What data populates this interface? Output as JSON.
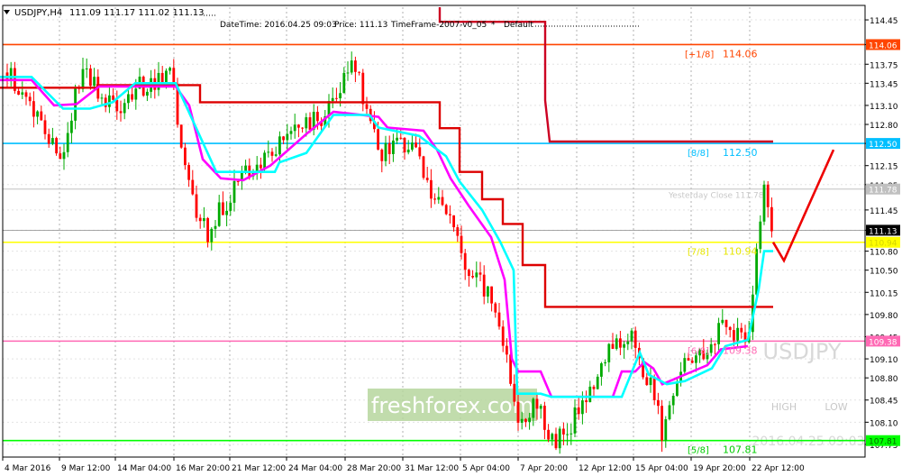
{
  "chart_data": {
    "type": "candlestick",
    "symbol_header": "USDJPY,H4",
    "ohlc_header": "111.09 111.17 111.02 111.13",
    "info": {
      "datetime": "DateTime: 2016.04.25 09:03",
      "price": "Price: 111.13",
      "timeframe": "TimeFrame-2007-v0_05",
      "preset": "Default"
    },
    "ylim": [
      107.55,
      114.65
    ],
    "y_ticks": [
      "114.45",
      "114.06",
      "113.75",
      "113.45",
      "113.10",
      "112.80",
      "112.50",
      "112.15",
      "111.85",
      "111.45",
      "111.13",
      "110.80",
      "110.50",
      "110.15",
      "109.80",
      "109.45",
      "109.10",
      "108.80",
      "108.45",
      "108.10",
      "107.75"
    ],
    "x_ticks": [
      "4 Mar 2016",
      "9 Mar 12:00",
      "14 Mar 04:00",
      "16 Mar 20:00",
      "21 Mar 12:00",
      "24 Mar 04:00",
      "28 Mar 20:00",
      "31 Mar 12:00",
      "5 Apr 04:00",
      "7 Apr 20:00",
      "12 Apr 12:00",
      "15 Apr 04:00",
      "19 Apr 20:00",
      "22 Apr 12:00"
    ],
    "levels": [
      {
        "name": "+1/8",
        "value": 114.06,
        "label": "[+1/8]",
        "value_label": "114.06",
        "badge": "114.06",
        "color": "#ff4500"
      },
      {
        "name": "8/8",
        "value": 112.5,
        "label": "[8/8]",
        "value_label": "112.50",
        "badge": "112.50",
        "color": "#00bfff"
      },
      {
        "name": "yesterday",
        "value": 111.78,
        "label": "Yesterday Close 111.78",
        "value_label": "",
        "badge": "111.78",
        "color": "#c0c0c0"
      },
      {
        "name": "7/8",
        "value": 110.94,
        "label": "[7/8]",
        "value_label": "110.94",
        "badge": "110.94",
        "color": "#ffff00"
      },
      {
        "name": "6/8",
        "value": 109.38,
        "label": "[6/8]",
        "value_label": "109.38",
        "badge": "109.38",
        "color": "#ff69b4"
      },
      {
        "name": "5/8",
        "value": 107.81,
        "label": "[5/8]",
        "value_label": "107.81",
        "badge": "107.81",
        "color": "#00ff00"
      }
    ],
    "current_price": {
      "value": 111.13,
      "badge": "111.13"
    },
    "watermark": {
      "symbol": "USDJPY",
      "high": "HIGH",
      "low": "LOW",
      "date": "2016.04.25 09:03"
    },
    "logo": "freshforex.com",
    "colors": {
      "bull": "#00aa00",
      "bear": "#ff0000",
      "red_line": "#dd0000",
      "magenta_line": "#ff00ff",
      "cyan_line": "#00ffff"
    },
    "red_stair": [
      [
        0,
        113.38
      ],
      [
        108,
        113.38
      ],
      [
        108,
        113.42
      ],
      [
        222,
        113.42
      ],
      [
        222,
        113.15
      ],
      [
        488,
        113.15
      ],
      [
        488,
        112.74
      ],
      [
        510,
        112.74
      ],
      [
        510,
        112.48
      ],
      [
        510,
        112.05
      ],
      [
        535,
        112.05
      ],
      [
        535,
        111.62
      ],
      [
        558,
        111.62
      ],
      [
        558,
        111.23
      ],
      [
        580,
        111.23
      ],
      [
        580,
        110.58
      ],
      [
        605,
        110.58
      ],
      [
        605,
        109.92
      ],
      [
        858,
        109.92
      ]
    ],
    "red_top": [
      [
        488,
        114.65
      ],
      [
        488,
        114.42
      ],
      [
        605,
        114.42
      ],
      [
        605,
        113.18
      ],
      [
        610,
        112.53
      ],
      [
        858,
        112.53
      ]
    ],
    "magenta_line": [
      [
        0,
        113.5
      ],
      [
        35,
        113.5
      ],
      [
        60,
        113.1
      ],
      [
        85,
        113.12
      ],
      [
        110,
        113.4
      ],
      [
        195,
        113.4
      ],
      [
        210,
        113.1
      ],
      [
        225,
        112.25
      ],
      [
        245,
        111.95
      ],
      [
        270,
        111.92
      ],
      [
        300,
        112.15
      ],
      [
        340,
        112.65
      ],
      [
        370,
        113.0
      ],
      [
        420,
        112.92
      ],
      [
        430,
        112.75
      ],
      [
        470,
        112.7
      ],
      [
        485,
        112.4
      ],
      [
        500,
        111.95
      ],
      [
        520,
        111.52
      ],
      [
        545,
        111.02
      ],
      [
        560,
        110.35
      ],
      [
        568,
        109.1
      ],
      [
        575,
        108.9
      ],
      [
        600,
        108.9
      ],
      [
        612,
        108.5
      ],
      [
        680,
        108.5
      ],
      [
        690,
        108.9
      ],
      [
        705,
        108.9
      ],
      [
        715,
        109.05
      ],
      [
        725,
        108.95
      ],
      [
        735,
        108.7
      ],
      [
        760,
        108.85
      ],
      [
        785,
        109.0
      ],
      [
        800,
        109.25
      ],
      [
        830,
        109.3
      ]
    ],
    "cyan_line": [
      [
        0,
        113.55
      ],
      [
        35,
        113.55
      ],
      [
        70,
        113.05
      ],
      [
        100,
        113.05
      ],
      [
        125,
        113.15
      ],
      [
        150,
        113.45
      ],
      [
        195,
        113.45
      ],
      [
        240,
        112.05
      ],
      [
        305,
        112.05
      ],
      [
        310,
        112.2
      ],
      [
        340,
        112.35
      ],
      [
        370,
        112.95
      ],
      [
        410,
        112.95
      ],
      [
        420,
        112.75
      ],
      [
        465,
        112.62
      ],
      [
        495,
        112.3
      ],
      [
        510,
        111.9
      ],
      [
        535,
        111.45
      ],
      [
        555,
        110.95
      ],
      [
        570,
        110.5
      ],
      [
        574,
        108.55
      ],
      [
        600,
        108.55
      ],
      [
        612,
        108.5
      ],
      [
        690,
        108.5
      ],
      [
        710,
        109.2
      ],
      [
        720,
        108.85
      ],
      [
        740,
        108.7
      ],
      [
        760,
        108.75
      ],
      [
        790,
        108.95
      ],
      [
        805,
        109.3
      ],
      [
        830,
        109.4
      ],
      [
        842,
        110.2
      ],
      [
        848,
        110.8
      ],
      [
        858,
        110.8
      ]
    ],
    "candles_seed": 24,
    "candle_path": [
      [
        8,
        113.62
      ],
      [
        30,
        113.25
      ],
      [
        55,
        112.55
      ],
      [
        68,
        112.3
      ],
      [
        80,
        113.05
      ],
      [
        95,
        113.7
      ],
      [
        115,
        113.2
      ],
      [
        130,
        113.05
      ],
      [
        150,
        113.4
      ],
      [
        175,
        113.45
      ],
      [
        190,
        113.55
      ],
      [
        205,
        112.1
      ],
      [
        215,
        111.6
      ],
      [
        230,
        111.1
      ],
      [
        250,
        111.55
      ],
      [
        270,
        111.95
      ],
      [
        290,
        112.25
      ],
      [
        305,
        112.35
      ],
      [
        325,
        112.8
      ],
      [
        345,
        112.85
      ],
      [
        360,
        112.9
      ],
      [
        375,
        113.3
      ],
      [
        395,
        113.75
      ],
      [
        410,
        112.8
      ],
      [
        420,
        112.35
      ],
      [
        440,
        112.45
      ],
      [
        460,
        112.4
      ],
      [
        480,
        111.75
      ],
      [
        500,
        111.35
      ],
      [
        520,
        110.45
      ],
      [
        540,
        110.2
      ],
      [
        555,
        109.7
      ],
      [
        565,
        108.9
      ],
      [
        575,
        108.2
      ],
      [
        585,
        108.2
      ],
      [
        595,
        108.5
      ],
      [
        605,
        107.95
      ],
      [
        615,
        107.85
      ],
      [
        630,
        107.9
      ],
      [
        645,
        108.4
      ],
      [
        660,
        108.8
      ],
      [
        675,
        109.3
      ],
      [
        690,
        109.3
      ],
      [
        705,
        109.4
      ],
      [
        715,
        108.7
      ],
      [
        725,
        108.6
      ],
      [
        735,
        107.9
      ],
      [
        745,
        108.5
      ],
      [
        760,
        109.05
      ],
      [
        775,
        109.15
      ],
      [
        790,
        109.4
      ],
      [
        800,
        109.65
      ],
      [
        810,
        109.55
      ],
      [
        820,
        109.5
      ],
      [
        830,
        109.2
      ],
      [
        836,
        110.1
      ],
      [
        842,
        111.15
      ],
      [
        848,
        111.75
      ],
      [
        853,
        111.4
      ],
      [
        858,
        111.13
      ]
    ],
    "red_arrow": [
      [
        858,
        110.94
      ],
      [
        870,
        110.65
      ],
      [
        925,
        112.4
      ]
    ]
  }
}
